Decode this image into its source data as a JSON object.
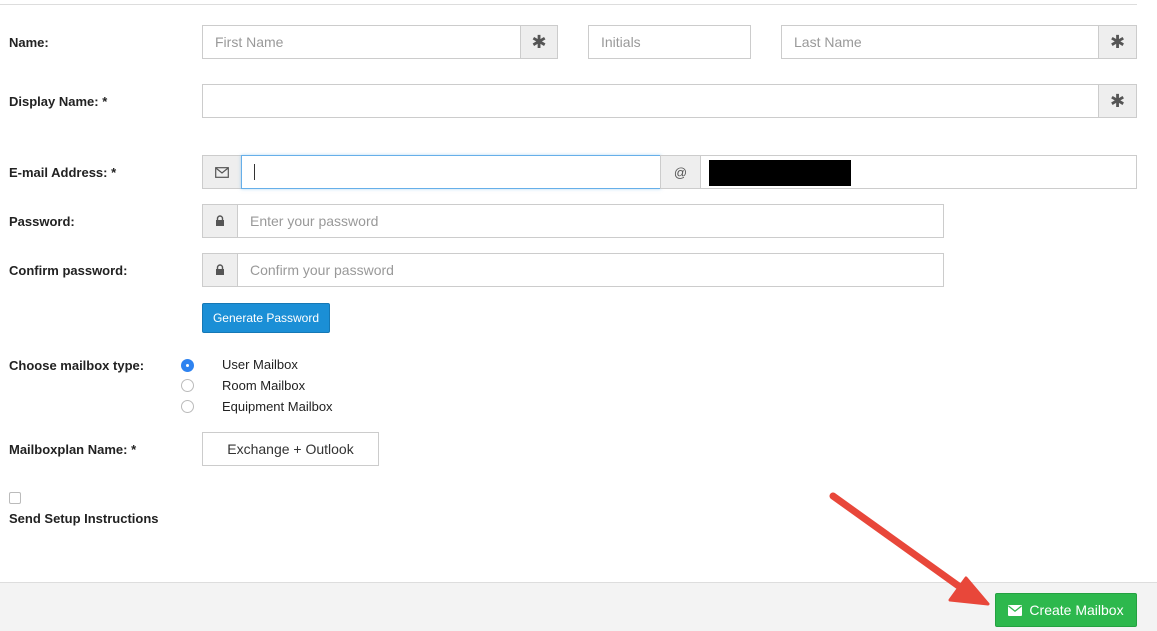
{
  "form": {
    "name_label": "Name:",
    "first_name_placeholder": "First Name",
    "initials_placeholder": "Initials",
    "last_name_placeholder": "Last Name",
    "display_name_label": "Display Name: *",
    "email_label": "E-mail Address: *",
    "at_symbol": "@",
    "password_label": "Password:",
    "password_placeholder": "Enter your password",
    "confirm_label": "Confirm password:",
    "confirm_placeholder": "Confirm your password",
    "generate_button": "Generate Password",
    "mailbox_type_label": "Choose mailbox type:",
    "mailbox_types": [
      "User Mailbox",
      "Room Mailbox",
      "Equipment Mailbox"
    ],
    "mailbox_type_selected": "User Mailbox",
    "mailboxplan_label": "Mailboxplan Name: *",
    "mailboxplan_value": "Exchange + Outlook",
    "send_setup_label": "Send Setup Instructions"
  },
  "footer": {
    "create_button": "Create Mailbox"
  },
  "icons": {
    "required": "asterisk-icon",
    "email": "envelope-icon",
    "password": "lock-icon",
    "create": "envelope-icon",
    "annotation": "red-arrow"
  },
  "colors": {
    "primary": "#1b8fd6",
    "success": "#2db84d",
    "radio_selected": "#2e83f0",
    "annotation_arrow": "#e8473a"
  }
}
